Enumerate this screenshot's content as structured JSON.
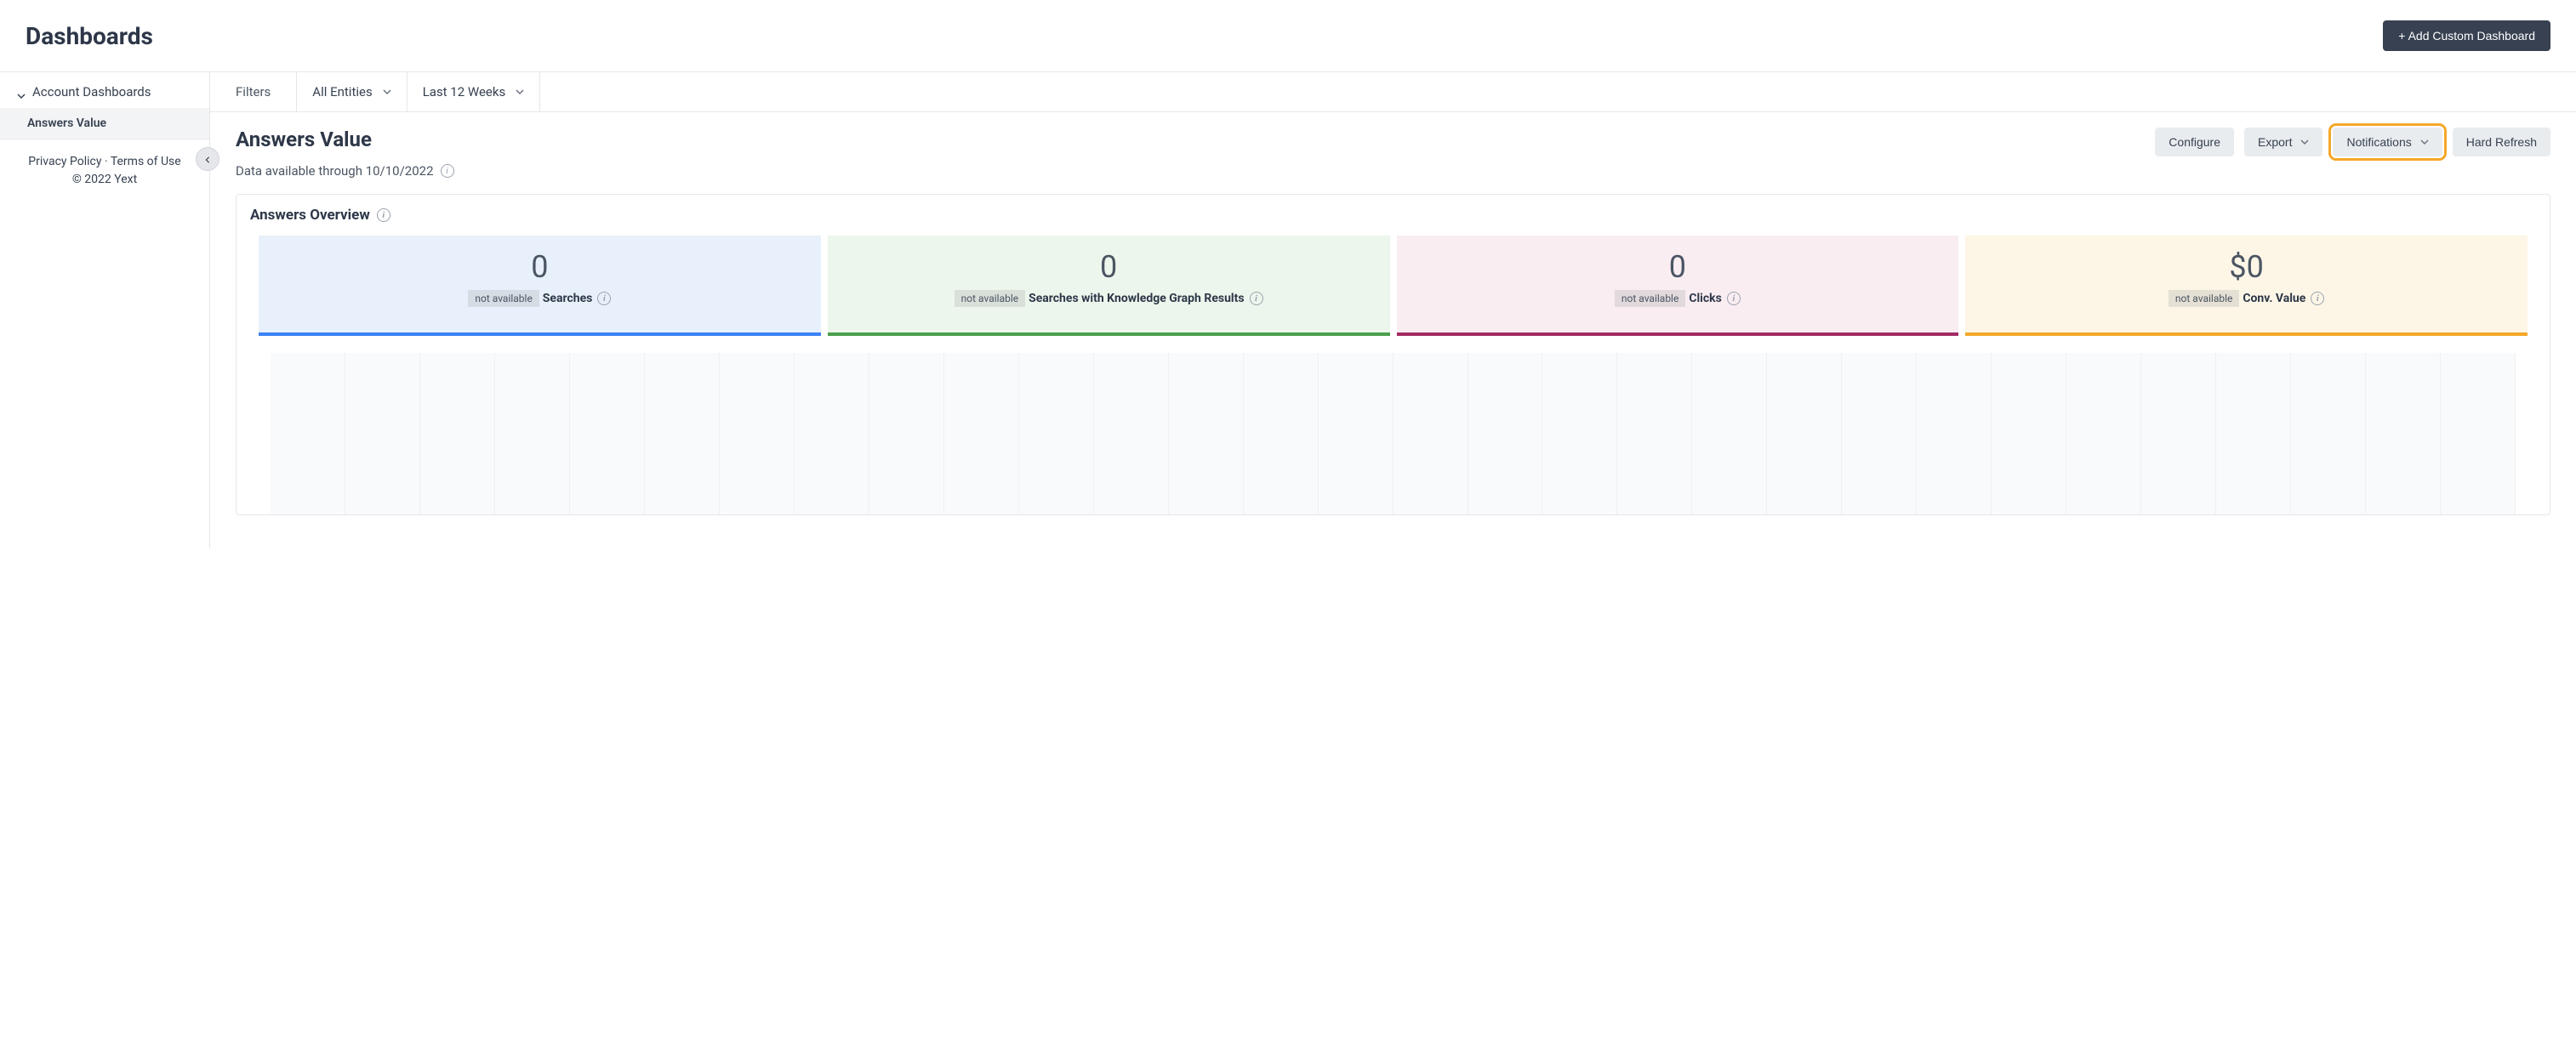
{
  "header": {
    "title": "Dashboards",
    "add_button": "+ Add Custom Dashboard"
  },
  "sidebar": {
    "section_label": "Account Dashboards",
    "items": [
      {
        "label": "Answers Value"
      }
    ],
    "footer": {
      "privacy": "Privacy Policy",
      "separator": " · ",
      "terms": "Terms of Use",
      "copyright": "© 2022 Yext"
    }
  },
  "filter_bar": {
    "label": "Filters",
    "entity_filter": "All Entities",
    "date_filter": "Last 12 Weeks"
  },
  "content": {
    "title": "Answers Value",
    "data_available": "Data available through 10/10/2022"
  },
  "actions": {
    "configure": "Configure",
    "export": "Export",
    "notifications": "Notifications",
    "hard_refresh": "Hard Refresh"
  },
  "overview": {
    "heading": "Answers Overview",
    "badge_text": "not available",
    "metrics": [
      {
        "value": "0",
        "label": "Searches"
      },
      {
        "value": "0",
        "label": "Searches with Knowledge Graph Results"
      },
      {
        "value": "0",
        "label": "Clicks"
      },
      {
        "value": "$0",
        "label": "Conv. Value"
      }
    ]
  },
  "chart_data": {
    "type": "line",
    "title": "",
    "categories": [],
    "series": [],
    "note": "empty chart area with vertical gridlines, no data plotted"
  }
}
